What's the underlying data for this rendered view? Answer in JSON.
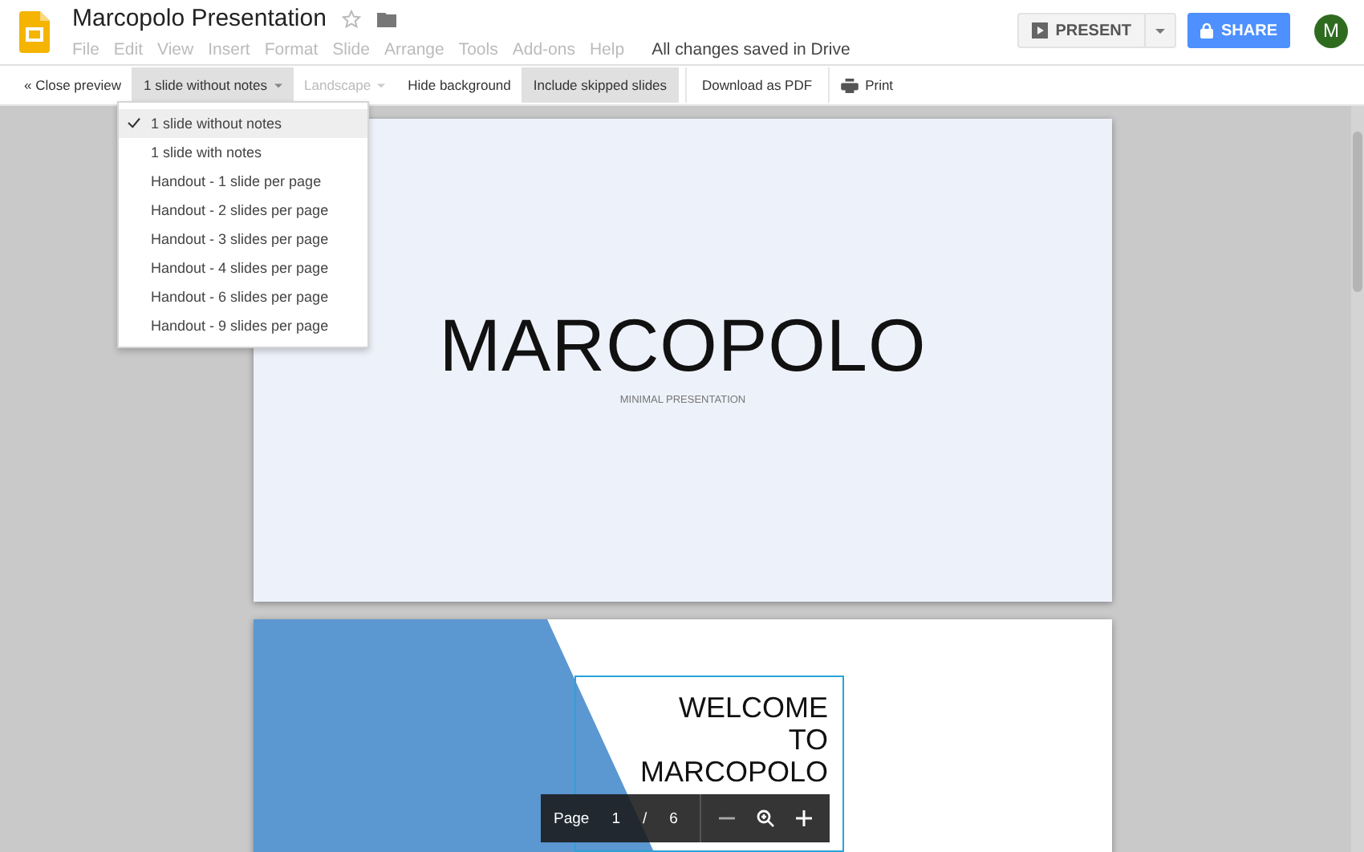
{
  "app": {
    "title": "Marcopolo Presentation",
    "menu": [
      "File",
      "Edit",
      "View",
      "Insert",
      "Format",
      "Slide",
      "Arrange",
      "Tools",
      "Add-ons",
      "Help"
    ],
    "save_status": "All changes saved in Drive",
    "present_label": "PRESENT",
    "share_label": "SHARE",
    "avatar": "M"
  },
  "toolbar": {
    "items": [
      {
        "kind": "link",
        "label": "« Close preview"
      },
      {
        "kind": "dropdown",
        "label": "1 slide without notes",
        "expanded": true,
        "disabled": false
      },
      {
        "kind": "dropdown",
        "label": "Landscape",
        "expanded": false,
        "disabled": true
      },
      {
        "kind": "toggle",
        "label": "Hide background",
        "on": false
      },
      {
        "kind": "toggle",
        "label": "Include skipped slides",
        "on": true
      },
      {
        "kind": "button",
        "label": "Download as PDF"
      },
      {
        "kind": "print",
        "label": "Print"
      }
    ]
  },
  "layout_menu": {
    "items": [
      {
        "label": "1 slide without notes",
        "selected": true
      },
      {
        "label": "1 slide with notes",
        "selected": false
      },
      {
        "label": "Handout - 1 slide per page",
        "selected": false
      },
      {
        "label": "Handout - 2 slides per page",
        "selected": false
      },
      {
        "label": "Handout - 3 slides per page",
        "selected": false
      },
      {
        "label": "Handout - 4 slides per page",
        "selected": false
      },
      {
        "label": "Handout - 6 slides per page",
        "selected": false
      },
      {
        "label": "Handout - 9 slides per page",
        "selected": false
      }
    ]
  },
  "slides": [
    {
      "kind": "title",
      "title": "MARCOPOLO",
      "subtitle": "MINIMAL PRESENTATION"
    },
    {
      "kind": "welcome",
      "lines": [
        "WELCOME",
        "TO",
        "MARCOPOLO"
      ]
    }
  ],
  "page_bar": {
    "label": "Page",
    "current": "1",
    "separator": "/",
    "total": "6"
  }
}
